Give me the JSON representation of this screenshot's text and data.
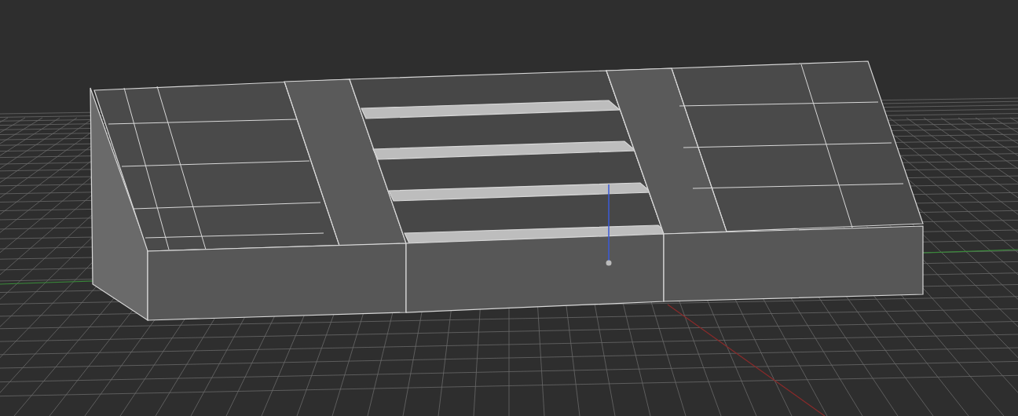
{
  "viewport": {
    "kind": "perspective",
    "grid": true
  }
}
